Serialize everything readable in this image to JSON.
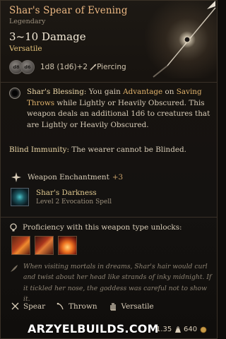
{
  "item": {
    "name": "Shar's Spear of Evening",
    "rarity": "Legendary",
    "damage": "3~10 Damage",
    "property": "Versatile",
    "dice": [
      "d8",
      "d6"
    ],
    "dice_formula": "1d8 (1d6)+2",
    "damage_type": "Piercing"
  },
  "blessing": {
    "title": "Shar's Blessing:",
    "t1": "You gain",
    "advantage": "Advantage",
    "t2": "on",
    "saving_throws": "Saving Throws",
    "t3": "while Lightly or Heavily Obscured. This weapon deals an additional 1d6 to creatures that are Lightly or Heavily Obscured."
  },
  "immunity": {
    "title": "Blind Immunity:",
    "text": "The wearer cannot be Blinded."
  },
  "enchantment": {
    "label": "Weapon Enchantment",
    "bonus": "+3"
  },
  "spell": {
    "name": "Shar's Darkness",
    "subtitle": "Level 2 Evocation Spell"
  },
  "proficiency": {
    "label": "Proficiency with this weapon type unlocks:",
    "actions": [
      "action-1",
      "action-2",
      "action-3"
    ]
  },
  "flavor": "When visiting mortals in dreams, Shar's hair would curl and twist about her head like strands of inky midnight. If it tickled her nose, the goddess was careful not to show it.",
  "tags": [
    "Spear",
    "Thrown",
    "Versatile"
  ],
  "footer": {
    "brand": "ARZYELBUILDS.COM",
    "weight": "1.35",
    "value": "640"
  },
  "colors": {
    "title": "#ecb883",
    "property": "#e3c27a",
    "keyword": "#e0b36c",
    "background": "#141210"
  }
}
